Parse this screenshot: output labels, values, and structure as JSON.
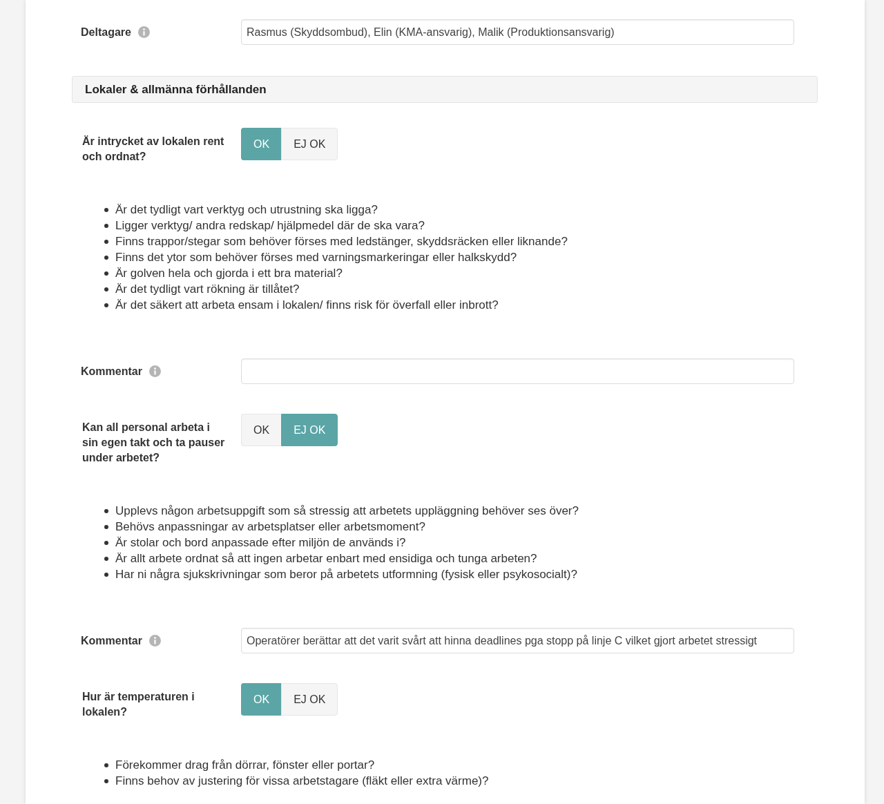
{
  "participants": {
    "label": "Deltagare",
    "value": "Rasmus (Skyddsombud), Elin (KMA-ansvarig), Malik (Produktionsansvarig)"
  },
  "section": {
    "title": "Lokaler & allmänna förhållanden",
    "questions": [
      {
        "question": "Är intrycket av lokalen rent och ordnat?",
        "options": [
          {
            "label": "OK",
            "selected": true
          },
          {
            "label": "EJ OK",
            "selected": false
          }
        ],
        "bullets": [
          "Är det tydligt vart verktyg och utrustning ska ligga?",
          "Ligger verktyg/ andra redskap/ hjälpmedel där de ska vara?",
          "Finns trappor/stegar som behöver förses med ledstänger, skyddsräcken eller liknande?",
          "Finns det ytor som behöver förses med varningsmarkeringar eller halkskydd?",
          "Är golven hela och gjorda i ett bra material?",
          "Är det tydligt vart rökning är tillåtet?",
          "Är det säkert att arbeta ensam i lokalen/ finns risk för överfall eller inbrott?"
        ],
        "comment": {
          "label": "Kommentar"
        }
      },
      {
        "question": "Kan all personal arbeta i sin egen takt och ta pauser under arbetet?",
        "options": [
          {
            "label": "OK",
            "selected": false
          },
          {
            "label": "EJ OK",
            "selected": true
          }
        ],
        "bullets": [
          "Upplevs någon arbetsuppgift som så stressig att arbetets uppläggning behöver ses över?",
          "Behövs anpassningar av arbetsplatser eller arbetsmoment?",
          "Är stolar och bord anpassade efter miljön de används i?",
          "Är allt arbete ordnat så att ingen arbetar enbart med ensidiga och tunga arbeten?",
          "Har ni några sjukskrivningar som beror på arbetets utformning (fysisk eller psykosocialt)?"
        ],
        "comment": {
          "label": "Kommentar",
          "value": "Operatörer berättar att det varit svårt att hinna deadlines pga stopp på linje C vilket gjort arbetet stressigt"
        }
      },
      {
        "question": "Hur är temperaturen i lokalen?",
        "options": [
          {
            "label": "OK",
            "selected": true
          },
          {
            "label": "EJ OK",
            "selected": false
          }
        ],
        "bullets": [
          "Förekommer drag från dörrar, fönster eller portar?",
          "Finns behov av justering för vissa arbetstagare (fläkt eller extra värme)?"
        ]
      }
    ]
  }
}
